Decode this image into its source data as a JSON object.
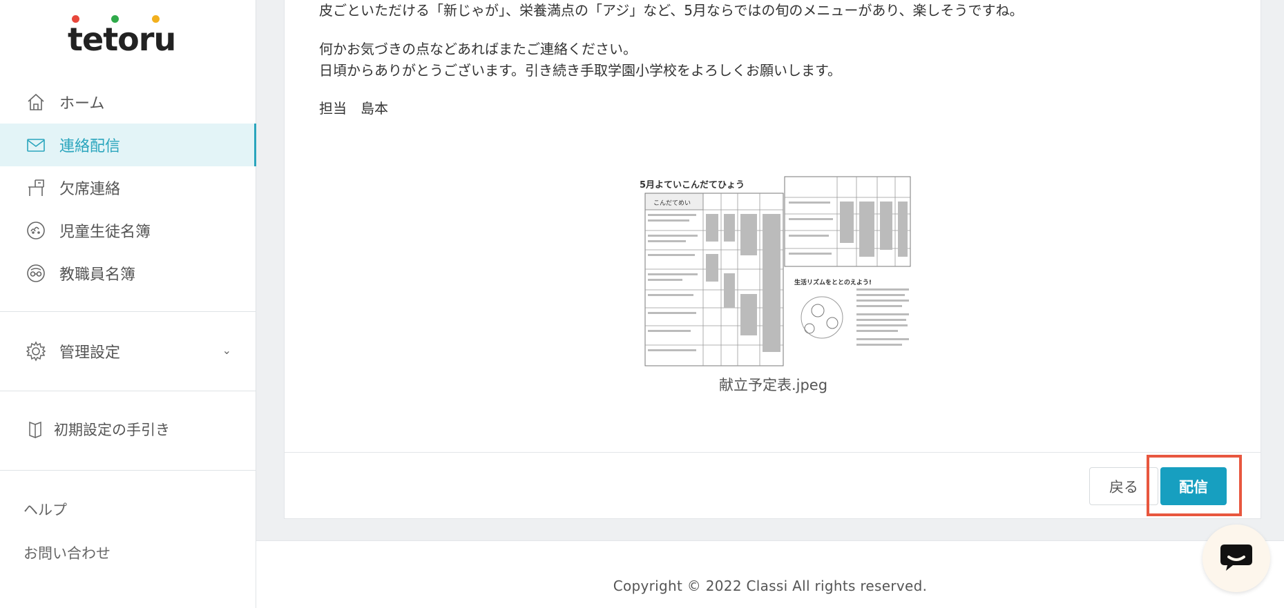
{
  "logo": {
    "text": "tetoru",
    "dot_colors": [
      "#e8473b",
      "#2faa4a",
      "#f2b01e"
    ]
  },
  "sidebar": {
    "items": [
      {
        "label": "ホーム",
        "icon": "home-icon",
        "active": false
      },
      {
        "label": "連絡配信",
        "icon": "mail-icon",
        "active": true
      },
      {
        "label": "欠席連絡",
        "icon": "desk-icon",
        "active": false
      },
      {
        "label": "児童生徒名簿",
        "icon": "student-face-icon",
        "active": false
      },
      {
        "label": "教職員名簿",
        "icon": "teacher-face-icon",
        "active": false
      }
    ],
    "settings_label": "管理設定",
    "guide_label": "初期設定の手引き",
    "help_label": "ヘルプ",
    "contact_label": "お問い合わせ"
  },
  "message": {
    "line1": "皮ごといただける「新じゃが」、栄養満点の「アジ」など、5月ならではの旬のメニューがあり、楽しそうですね。",
    "line2": "何かお気づきの点などあればまたご連絡ください。",
    "line3": "日頃からありがとうございます。引き続き手取学園小学校をよろしくお願いします。",
    "signature": "担当　島本"
  },
  "attachment": {
    "filename": "献立予定表.jpeg",
    "title": "5月よていこんだてひょう",
    "col_header": "こんだてめい",
    "sub_title": "生活リズムをととのえよう!"
  },
  "actions": {
    "back_label": "戻る",
    "send_label": "配信"
  },
  "footer": {
    "copyright": "Copyright © 2022 Classi All rights reserved."
  },
  "colors": {
    "accent": "#179fc0",
    "active_bg": "#e3f4f7",
    "highlight": "#e8573f"
  }
}
